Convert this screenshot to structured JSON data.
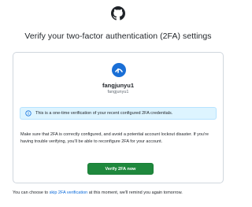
{
  "page": {
    "title": "Verify your two-factor authentication (2FA) settings",
    "logo_icon": "github-icon"
  },
  "account": {
    "username": "fangjunyu1",
    "login": "fangjunyu1",
    "avatar_icon": "user-avatar-icon",
    "avatar_color": "#1a6fd6"
  },
  "flash": {
    "icon": "info-icon",
    "text": "This is a one-time verification of your recent configured 2FA credentials."
  },
  "description": "Make sure that 2FA is correctly configured, and avoid a potential account lockout disaster. If you're having trouble verifying, you'll be able to reconfigure 2FA for your account.",
  "actions": {
    "verify_label": "Verify 2FA now",
    "verify_color": "#1f883d"
  },
  "footer": {
    "prefix": "You can choose to ",
    "link": "skip 2FA verification",
    "suffix": " at this moment, we'll remind you again tomorrow."
  }
}
